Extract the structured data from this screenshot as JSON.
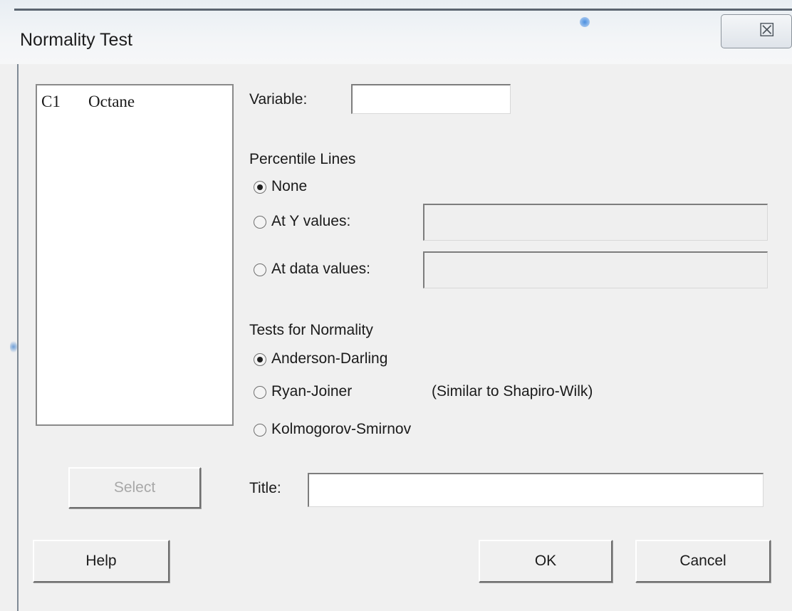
{
  "window": {
    "title": "Normality Test",
    "close_glyph": "☒"
  },
  "variables": [
    {
      "col": "C1",
      "name": "Octane"
    }
  ],
  "form": {
    "variable_label": "Variable:",
    "variable_value": "",
    "percentile_heading": "Percentile Lines",
    "percentile_options": [
      {
        "label": "None",
        "selected": true
      },
      {
        "label": "At Y values:",
        "selected": false
      },
      {
        "label": "At data values:",
        "selected": false
      }
    ],
    "tests_heading": "Tests for Normality",
    "tests_options": [
      {
        "label": "Anderson-Darling",
        "selected": true
      },
      {
        "label": "Ryan-Joiner",
        "note": "(Similar to Shapiro-Wilk)",
        "selected": false
      },
      {
        "label": "Kolmogorov-Smirnov",
        "selected": false
      }
    ],
    "title_label": "Title:",
    "title_value": ""
  },
  "buttons": {
    "select": "Select",
    "help": "Help",
    "ok": "OK",
    "cancel": "Cancel"
  },
  "icons": {
    "close": "close-icon",
    "radio_selected": "radio-selected-icon",
    "radio_unselected": "radio-unselected-icon"
  }
}
